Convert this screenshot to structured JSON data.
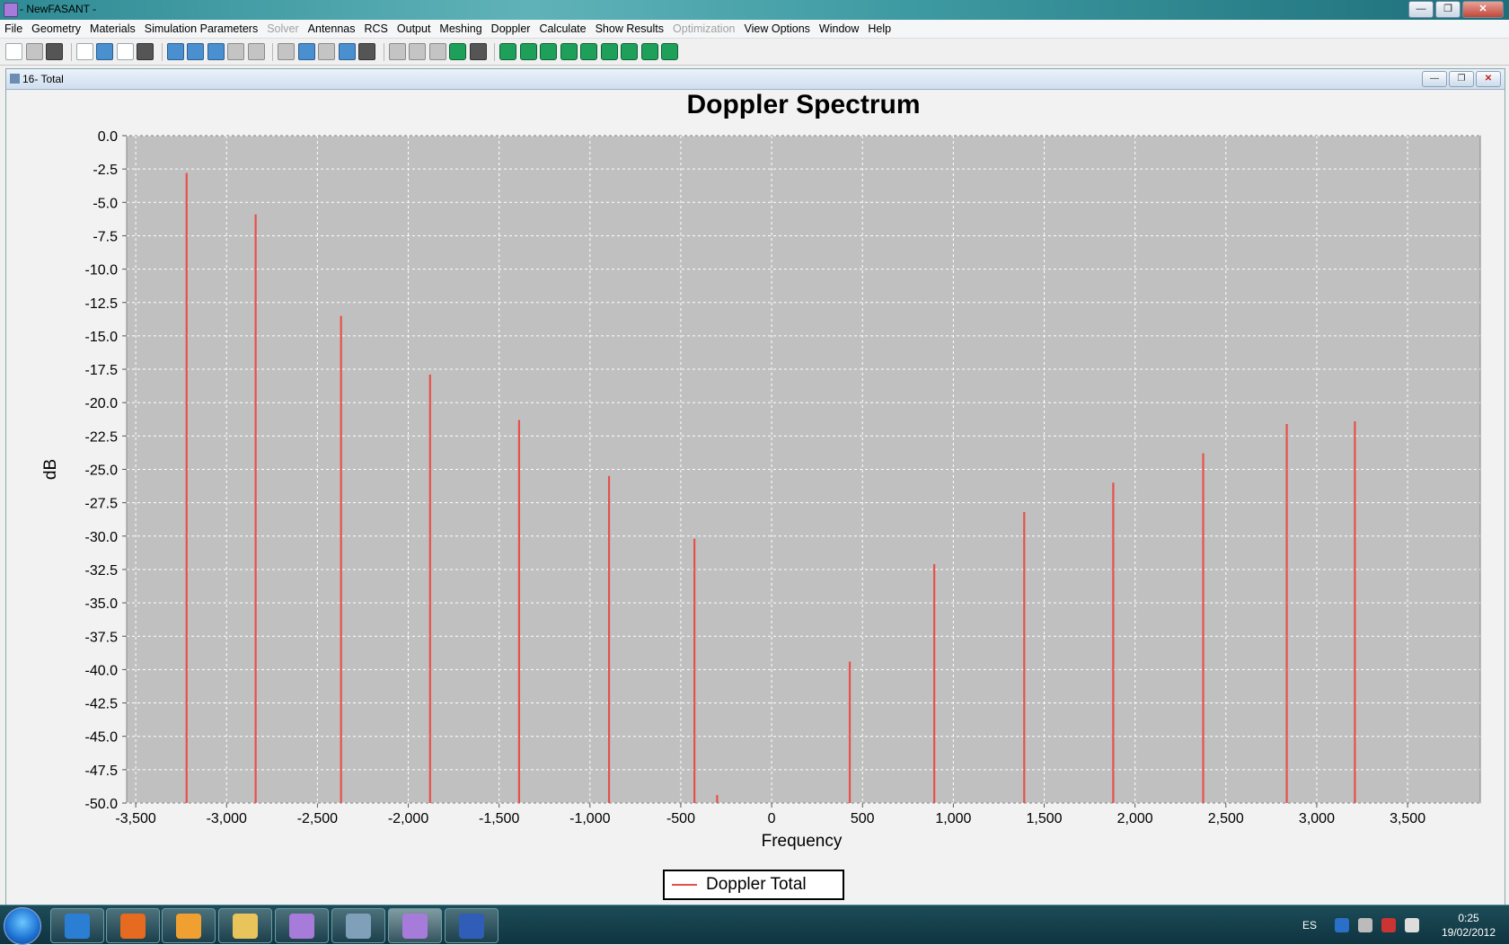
{
  "window": {
    "title": "- NewFASANT -"
  },
  "menu": [
    "File",
    "Geometry",
    "Materials",
    "Simulation Parameters",
    "Solver",
    "Antennas",
    "RCS",
    "Output",
    "Meshing",
    "Doppler",
    "Calculate",
    "Show Results",
    "Optimization",
    "View Options",
    "Window",
    "Help"
  ],
  "menu_disabled": [
    "Solver",
    "Optimization"
  ],
  "frame": {
    "title": "16- Total"
  },
  "chart_data": {
    "type": "line",
    "title": "Doppler Spectrum",
    "xlabel": "Frequency",
    "ylabel": "dB",
    "xlim": [
      -3550,
      3900
    ],
    "ylim": [
      -50,
      0
    ],
    "xticks": [
      -3500,
      -3000,
      -2500,
      -2000,
      -1500,
      -1000,
      -500,
      0,
      500,
      1000,
      1500,
      2000,
      2500,
      3000,
      3500
    ],
    "xtick_labels": [
      "-3,500",
      "-3,000",
      "-2,500",
      "-2,000",
      "-1,500",
      "-1,000",
      "-500",
      "0",
      "500",
      "1,000",
      "1,500",
      "2,000",
      "2,500",
      "3,000",
      "3,500"
    ],
    "yticks": [
      0,
      -2.5,
      -5,
      -7.5,
      -10,
      -12.5,
      -15,
      -17.5,
      -20,
      -22.5,
      -25,
      -27.5,
      -30,
      -32.5,
      -35,
      -37.5,
      -40,
      -42.5,
      -45,
      -47.5,
      -50
    ],
    "ytick_labels": [
      "0.0",
      "-2.5",
      "-5.0",
      "-7.5",
      "-10.0",
      "-12.5",
      "-15.0",
      "-17.5",
      "-20.0",
      "-22.5",
      "-25.0",
      "-27.5",
      "-30.0",
      "-32.5",
      "-35.0",
      "-37.5",
      "-40.0",
      "-42.5",
      "-45.0",
      "-47.5",
      "-50.0"
    ],
    "grid": true,
    "legend_position": "bottom-center",
    "series": [
      {
        "name": "Doppler Total",
        "color": "#e8504a",
        "points": [
          {
            "x": -3220,
            "y": -2.8
          },
          {
            "x": -2840,
            "y": -5.9
          },
          {
            "x": -2370,
            "y": -13.5
          },
          {
            "x": -1880,
            "y": -17.9
          },
          {
            "x": -1390,
            "y": -21.3
          },
          {
            "x": -895,
            "y": -25.5
          },
          {
            "x": -425,
            "y": -30.2
          },
          {
            "x": -300,
            "y": -49.4
          },
          {
            "x": 430,
            "y": -39.4
          },
          {
            "x": 895,
            "y": -32.1
          },
          {
            "x": 1390,
            "y": -28.2
          },
          {
            "x": 1880,
            "y": -26.0
          },
          {
            "x": 2375,
            "y": -23.8
          },
          {
            "x": 2835,
            "y": -21.6
          },
          {
            "x": 3210,
            "y": -21.4
          }
        ]
      }
    ]
  },
  "taskbar": {
    "apps": [
      {
        "name": "ie",
        "color": "#2a7fd4"
      },
      {
        "name": "firefox",
        "color": "#e66a1f"
      },
      {
        "name": "media-player",
        "color": "#f0a030"
      },
      {
        "name": "file-explorer",
        "color": "#e8c45a"
      },
      {
        "name": "newfasant-1",
        "color": "#a77bd9"
      },
      {
        "name": "computer",
        "color": "#7fa0b8"
      },
      {
        "name": "newfasant-2",
        "color": "#a77bd9"
      },
      {
        "name": "word",
        "color": "#2f5db8"
      }
    ],
    "lang": "ES",
    "time": "0:25",
    "date": "19/02/2012"
  }
}
